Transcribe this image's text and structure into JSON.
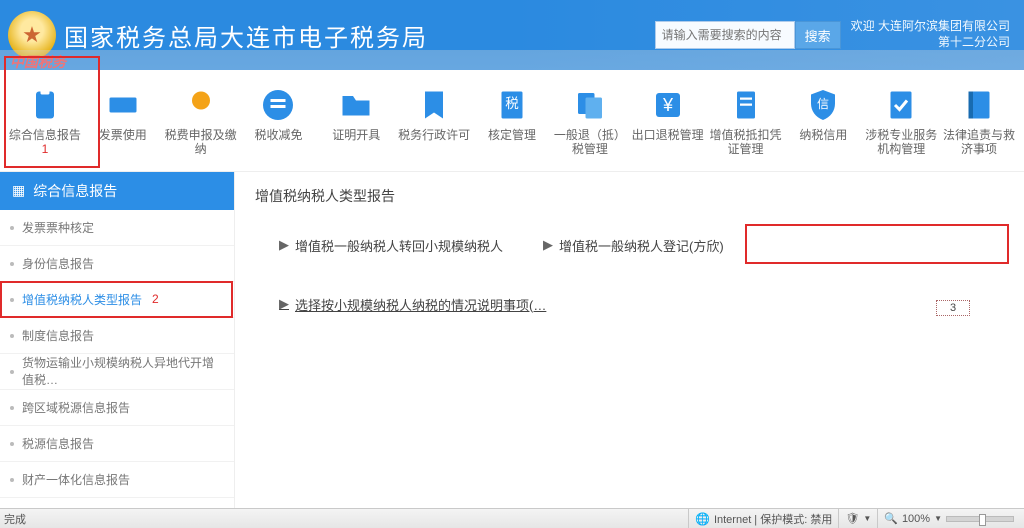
{
  "header": {
    "site_title": "国家税务总局大连市电子税务局",
    "red_script": "中国税务",
    "search_placeholder": "请输入需要搜索的内容",
    "search_btn": "搜索",
    "welcome": "欢迎 大连阿尔滨集团有限公司\n第十二分公司"
  },
  "toolbar": [
    {
      "label": "综合信息报告",
      "name": "toolbar-report"
    },
    {
      "label": "发票使用",
      "name": "toolbar-invoice"
    },
    {
      "label": "税费申报及缴纳",
      "name": "toolbar-tax-declare"
    },
    {
      "label": "税收减免",
      "name": "toolbar-tax-reduce"
    },
    {
      "label": "证明开具",
      "name": "toolbar-cert"
    },
    {
      "label": "税务行政许可",
      "name": "toolbar-admin"
    },
    {
      "label": "核定管理",
      "name": "toolbar-assess"
    },
    {
      "label": "一般退（抵）税管理",
      "name": "toolbar-refund"
    },
    {
      "label": "出口退税管理",
      "name": "toolbar-export"
    },
    {
      "label": "增值税抵扣凭证管理",
      "name": "toolbar-vat-voucher"
    },
    {
      "label": "纳税信用",
      "name": "toolbar-credit"
    },
    {
      "label": "涉税专业服务机构管理",
      "name": "toolbar-pro-service"
    },
    {
      "label": "法律追责与救济事项",
      "name": "toolbar-legal"
    }
  ],
  "annot": {
    "one": "1",
    "two": "2",
    "three": "3"
  },
  "sidebar": {
    "head": "综合信息报告",
    "items": [
      "发票票种核定",
      "身份信息报告",
      "增值税纳税人类型报告",
      "制度信息报告",
      "货物运输业小规模纳税人异地代开增值税…",
      "跨区域税源信息报告",
      "税源信息报告",
      "财产一体化信息报告"
    ]
  },
  "content": {
    "title": "增值税纳税人类型报告",
    "items": [
      "增值税一般纳税人转回小规模纳税人",
      "增值税一般纳税人登记(方欣)",
      "选择按小规模纳税人纳税的情况说明事项(…"
    ]
  },
  "status": {
    "done": "完成",
    "internet": "Internet | 保护模式: 禁用",
    "zoom": "100%"
  }
}
